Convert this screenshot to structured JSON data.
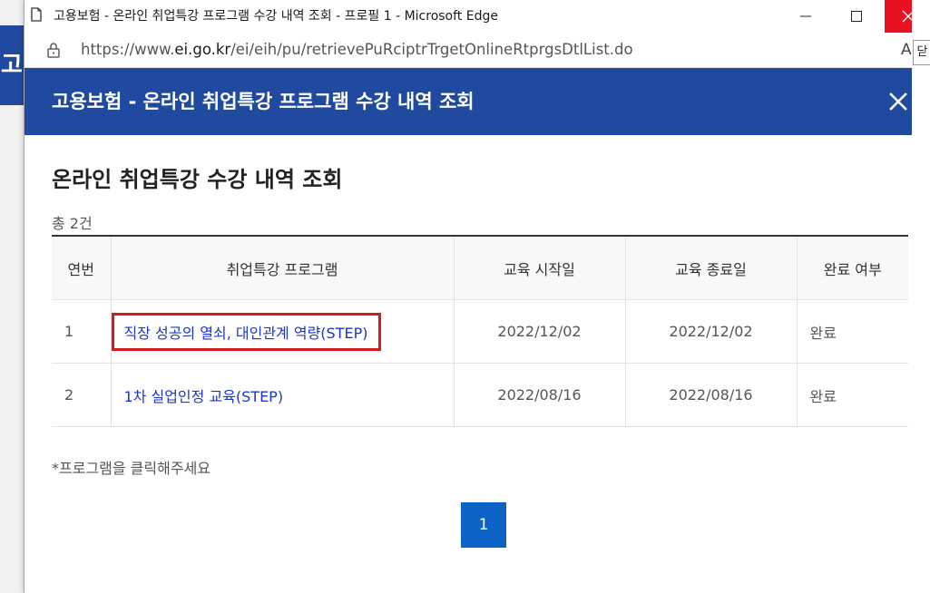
{
  "background": {
    "partial_text": "고",
    "tooltip_text": "닫"
  },
  "window": {
    "title": "고용보험 - 온라인 취업특강 프로그램 수강 내역 조회 - 프로필 1 - Microsoft Edge",
    "url_prefix": "https://www.",
    "url_domain": "ei.go.kr",
    "url_path": "/ei/eih/pu/retrievePuRciptrTrgetOnlineRtprgsDtlList.do",
    "reader_label": "A"
  },
  "popup": {
    "header_title": "고용보험 - 온라인 취업특강 프로그램 수강 내역 조회",
    "section_title": "온라인 취업특강 수강 내역 조회",
    "total_count": "총 2건",
    "table": {
      "headers": [
        "연번",
        "취업특강 프로그램",
        "교육 시작일",
        "교육 종료일",
        "완료 여부"
      ],
      "rows": [
        {
          "num": "1",
          "program": "직장 성공의 열쇠, 대인관계 역량(STEP)",
          "start": "2022/12/02",
          "end": "2022/12/02",
          "done": "완료"
        },
        {
          "num": "2",
          "program": "1차 실업인정 교육(STEP)",
          "start": "2022/08/16",
          "end": "2022/08/16",
          "done": "완료"
        }
      ]
    },
    "notice": "*프로그램을 클릭해주세요",
    "pagination": {
      "current_page": "1"
    }
  },
  "colors": {
    "header_blue": "#1f4aa0",
    "link": "#1a35c9",
    "highlight_border": "#d71920",
    "page_button": "#0b63c5",
    "close_red": "#e81123"
  },
  "icons": [
    "page-icon",
    "minimize-icon",
    "maximize-icon",
    "close-icon",
    "lock-icon",
    "popup-close-icon"
  ]
}
